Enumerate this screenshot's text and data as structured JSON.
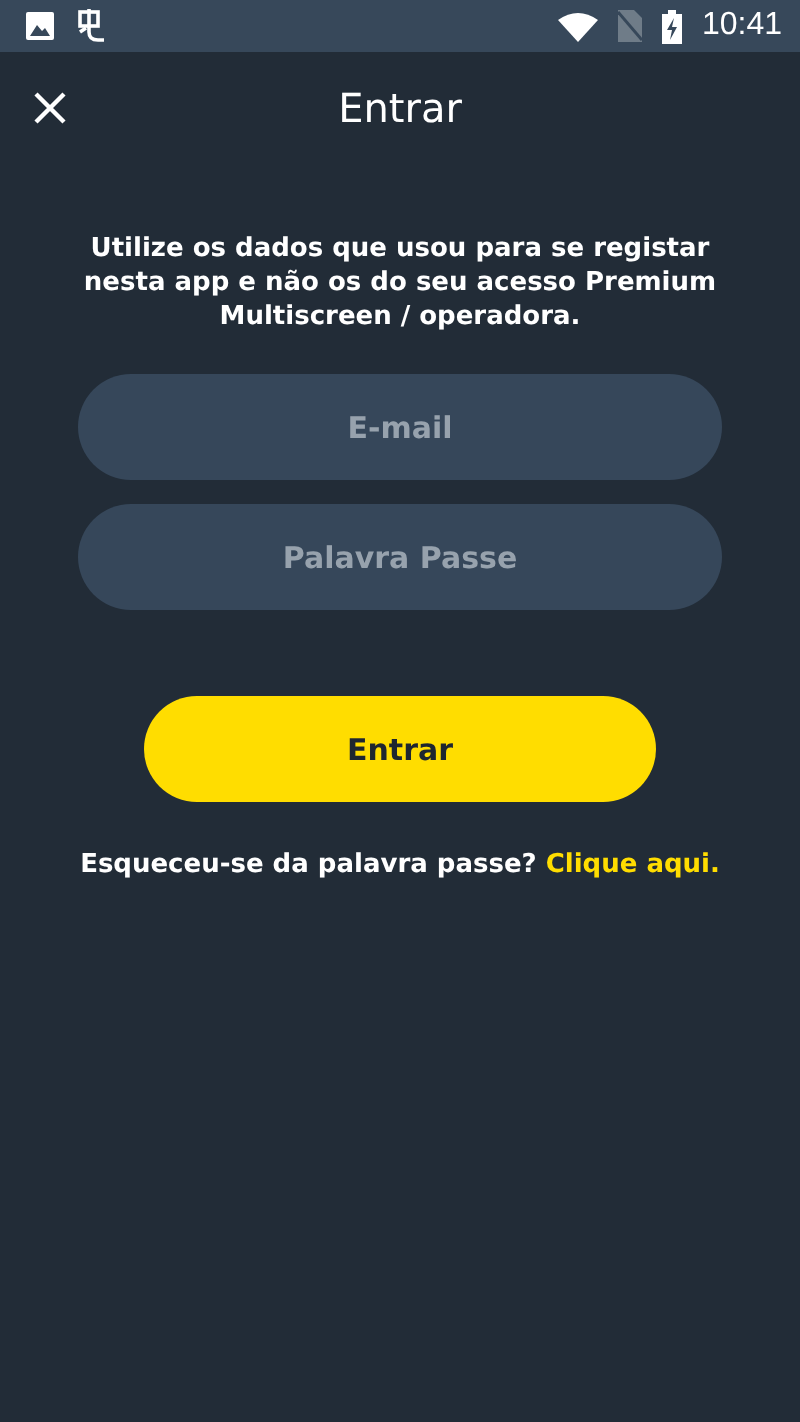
{
  "status_bar": {
    "time": "10:41"
  },
  "header": {
    "title": "Entrar"
  },
  "intro": "Utilize os dados que usou para se registar nesta app e não os do seu acesso Premium Multiscreen / operadora.",
  "fields": [
    {
      "placeholder": "E-mail"
    },
    {
      "placeholder": "Palavra Passe"
    }
  ],
  "submit": {
    "label": "Entrar"
  },
  "forgot": {
    "text": "Esqueceu-se da palavra passe?",
    "link": "Clique aqui."
  }
}
